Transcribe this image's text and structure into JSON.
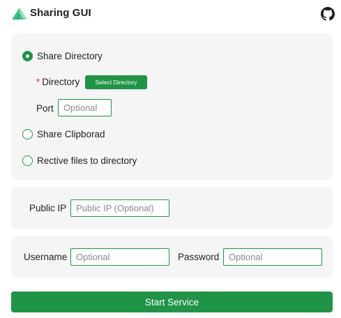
{
  "app": {
    "title": "Sharing GUI",
    "logo_icon": "triangle-logo-icon",
    "github_icon": "github-icon"
  },
  "colors": {
    "accent": "#1f9446",
    "panel_bg": "#f5f5f5",
    "required": "#d9363e"
  },
  "mode": {
    "selected": "share_directory",
    "options": [
      {
        "id": "share_directory",
        "label": "Share Directory",
        "checked": true
      },
      {
        "id": "share_clipboard",
        "label": "Share Clipborad",
        "checked": false
      },
      {
        "id": "receive_files",
        "label": "Rective files to directory",
        "checked": false
      }
    ]
  },
  "directory": {
    "required_mark": "*",
    "label": "Directory",
    "button_label": "Select Directory"
  },
  "port": {
    "label": "Port",
    "placeholder": "Optional",
    "value": ""
  },
  "public_ip": {
    "label": "Public IP",
    "placeholder": "Public IP (Optional)",
    "value": ""
  },
  "auth": {
    "username_label": "Username",
    "username_placeholder": "Optional",
    "password_label": "Password",
    "password_placeholder": "Optional"
  },
  "start_button": {
    "label": "Start Service"
  }
}
